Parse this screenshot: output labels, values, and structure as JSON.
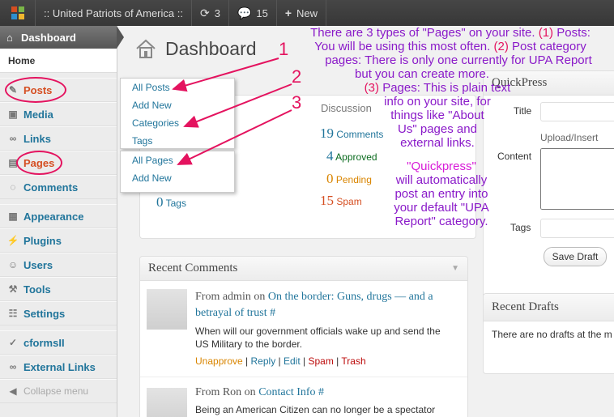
{
  "adminbar": {
    "site_title": ":: United Patriots of America ::",
    "updates_count": "3",
    "comments_count": "15",
    "new_label": "New"
  },
  "sidebar": {
    "dashboard": "Dashboard",
    "home": "Home",
    "items": {
      "posts": "Posts",
      "media": "Media",
      "links": "Links",
      "pages": "Pages",
      "comments": "Comments",
      "appearance": "Appearance",
      "plugins": "Plugins",
      "users": "Users",
      "tools": "Tools",
      "settings": "Settings",
      "cforms": "cformsII",
      "external_links": "External Links",
      "collapse": "Collapse menu"
    }
  },
  "posts_flyout": {
    "all_posts": "All Posts",
    "add_new": "Add New",
    "categories": "Categories",
    "tags": "Tags"
  },
  "pages_flyout": {
    "all_pages": "All Pages",
    "add_new": "Add New"
  },
  "page_title": "Dashboard",
  "right_now": {
    "discussion_header": "Discussion",
    "tags_count": "0",
    "tags_label": "Tags",
    "comments": {
      "count": "19",
      "label": "Comments"
    },
    "approved": {
      "count": "4",
      "label": "Approved"
    },
    "pending": {
      "count": "0",
      "label": "Pending"
    },
    "spam": {
      "count": "15",
      "label": "Spam"
    }
  },
  "annotation": {
    "line1": "There are 3 types of \"Pages\" on your site.",
    "n1": "(1)",
    "line1b": "Posts:",
    "line2": "You will be using this most often.",
    "n2": "(2)",
    "line2b": "Post category",
    "line3": "pages: There is only one currently for UPA Report",
    "line4": "but you can create more.",
    "n3": "(3)",
    "line5": "Pages: This is plain text",
    "line6": "info on your site, for",
    "line7": "things like \"About",
    "line8": "Us\" pages and",
    "line9": "external links.",
    "line10": "\"Quickpress\"",
    "line11": "will automatically",
    "line12": "post an entry into",
    "line13": "your default \"UPA",
    "line14": "Report\" category.",
    "arrow1": "1",
    "arrow2": "2",
    "arrow3": "3"
  },
  "quickpress": {
    "title": "QuickPress",
    "title_label": "Title",
    "upload_label": "Upload/Insert",
    "content_label": "Content",
    "tags_label": "Tags",
    "save_draft": "Save Draft"
  },
  "recent_drafts": {
    "title": "Recent Drafts",
    "empty": "There are no drafts at the m"
  },
  "recent_comments": {
    "title": "Recent Comments",
    "items": [
      {
        "from": "From admin on",
        "post": "On the border: Guns, drugs — and a betrayal of trust #",
        "excerpt": "When will our government officials wake up and send the US Military to the border.",
        "actions": [
          "Unapprove",
          "Reply",
          "Edit",
          "Spam",
          "Trash"
        ]
      },
      {
        "from": "From Ron on",
        "post": "Contact Info #",
        "excerpt": "Being an American Citizen can no longer be a spectator"
      }
    ]
  },
  "colors": {
    "annotation": "#8a1ac9",
    "highlight": "#e4135f",
    "link": "#21759b"
  }
}
